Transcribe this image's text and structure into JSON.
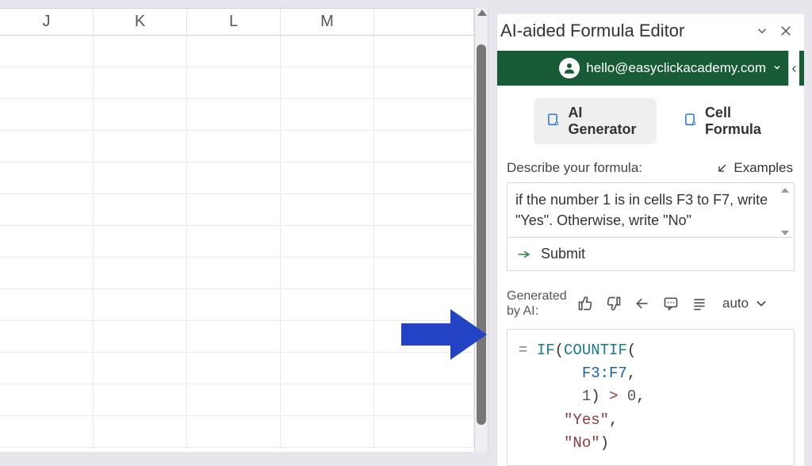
{
  "columns": [
    "J",
    "K",
    "L",
    "M"
  ],
  "panel": {
    "title": "AI-aided Formula Editor",
    "account_email": "hello@easyclickacademy.com",
    "tabs": [
      {
        "label": "AI Generator",
        "active": true
      },
      {
        "label": "Cell Formula",
        "active": false
      }
    ],
    "describe_label": "Describe your formula:",
    "examples_label": "Examples",
    "prompt_text": "if the number 1 is in cells F3 to F7, write \"Yes\". Otherwise, write \"No\"",
    "submit_label": "Submit",
    "generated_label": "Generated by AI:",
    "mode_label": "auto",
    "formula": {
      "tokens": [
        {
          "type": "eq",
          "text": "= "
        },
        {
          "type": "fn",
          "text": "IF"
        },
        {
          "type": "pn",
          "text": "("
        },
        {
          "type": "fn",
          "text": "COUNTIF"
        },
        {
          "type": "pn",
          "text": "("
        },
        {
          "type": "nl",
          "text": "\n       "
        },
        {
          "type": "ref",
          "text": "F3:F7"
        },
        {
          "type": "pn",
          "text": ","
        },
        {
          "type": "nl",
          "text": "\n       "
        },
        {
          "type": "num",
          "text": "1"
        },
        {
          "type": "pn",
          "text": ") "
        },
        {
          "type": "op",
          "text": ">"
        },
        {
          "type": "pn",
          "text": " "
        },
        {
          "type": "num",
          "text": "0"
        },
        {
          "type": "pn",
          "text": ","
        },
        {
          "type": "nl",
          "text": "\n     "
        },
        {
          "type": "str",
          "text": "\"Yes\""
        },
        {
          "type": "pn",
          "text": ","
        },
        {
          "type": "nl",
          "text": "\n     "
        },
        {
          "type": "str",
          "text": "\"No\""
        },
        {
          "type": "pn",
          "text": ")"
        }
      ]
    }
  }
}
